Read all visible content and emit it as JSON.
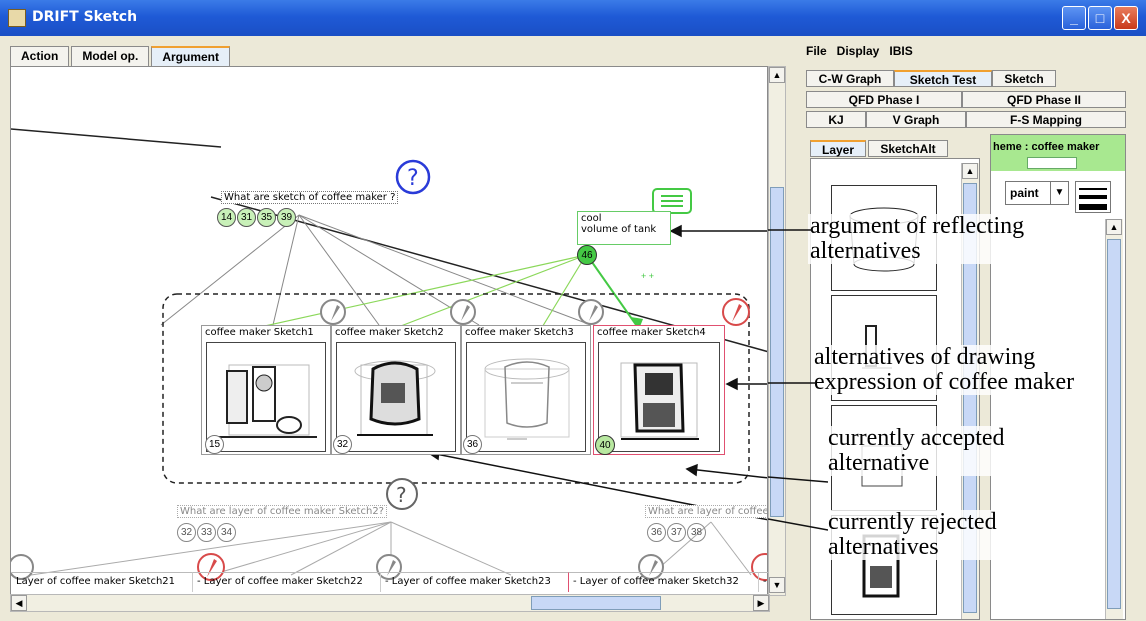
{
  "window": {
    "title": "DRIFT Sketch",
    "btn_min": "_",
    "btn_max": "□",
    "btn_close": "X"
  },
  "left_tabs": [
    "Action",
    "Model op.",
    "Argument"
  ],
  "menu": [
    "File",
    "Display",
    "IBIS"
  ],
  "right_tabs_row1": [
    "C-W Graph",
    "Sketch Test",
    "Sketch"
  ],
  "right_tabs_row2": [
    "QFD Phase I",
    "QFD Phase II"
  ],
  "right_tabs_row3": [
    "KJ",
    "V Graph",
    "F-S Mapping"
  ],
  "sub_tabs": [
    "Layer",
    "SketchAlt"
  ],
  "theme_label": "heme : coffee maker",
  "paint_select": "paint",
  "question_node": {
    "label": "What are sketch of coffee maker  ?",
    "numbers": [
      "14",
      "31",
      "35",
      "39"
    ]
  },
  "argument_node": {
    "line1": "cool",
    "line2": "volume of tank",
    "number": "46"
  },
  "sketches": [
    {
      "label": "coffee maker   Sketch1",
      "number": "15"
    },
    {
      "label": "coffee maker   Sketch2",
      "number": "32"
    },
    {
      "label": "coffee maker   Sketch3",
      "number": "36"
    },
    {
      "label": "coffee maker   Sketch4",
      "number": "40"
    }
  ],
  "layer_question_1": {
    "label": "What are layer of coffee maker   Sketch2?",
    "numbers": [
      "32",
      "33",
      "34"
    ]
  },
  "layer_question_2": {
    "label": "What are layer of coffee",
    "numbers": [
      "36",
      "37",
      "38"
    ]
  },
  "layer_bars": [
    "Layer of coffee maker   Sketch21",
    "- Layer of coffee maker   Sketch22",
    "- Layer of coffee maker   Sketch23",
    "- Layer of coffee maker   Sketch32",
    "-"
  ],
  "plus_marks": "+ +",
  "annotations": {
    "a1_l1": "argument of reflecting",
    "a1_l2": "alternatives",
    "a2_l1": "alternatives of drawing",
    "a2_l2": "expression of coffee maker",
    "a3_l1": "currently accepted",
    "a3_l2": "alternative",
    "a4_l1": "currently rejected",
    "a4_l2": "alternatives"
  },
  "colors": {
    "titlebar": "#1f5ad6",
    "accepted": "#e05070",
    "question_icon": "#2a3bd8",
    "arg_green": "#44c944",
    "panel_green": "#a8e890"
  }
}
